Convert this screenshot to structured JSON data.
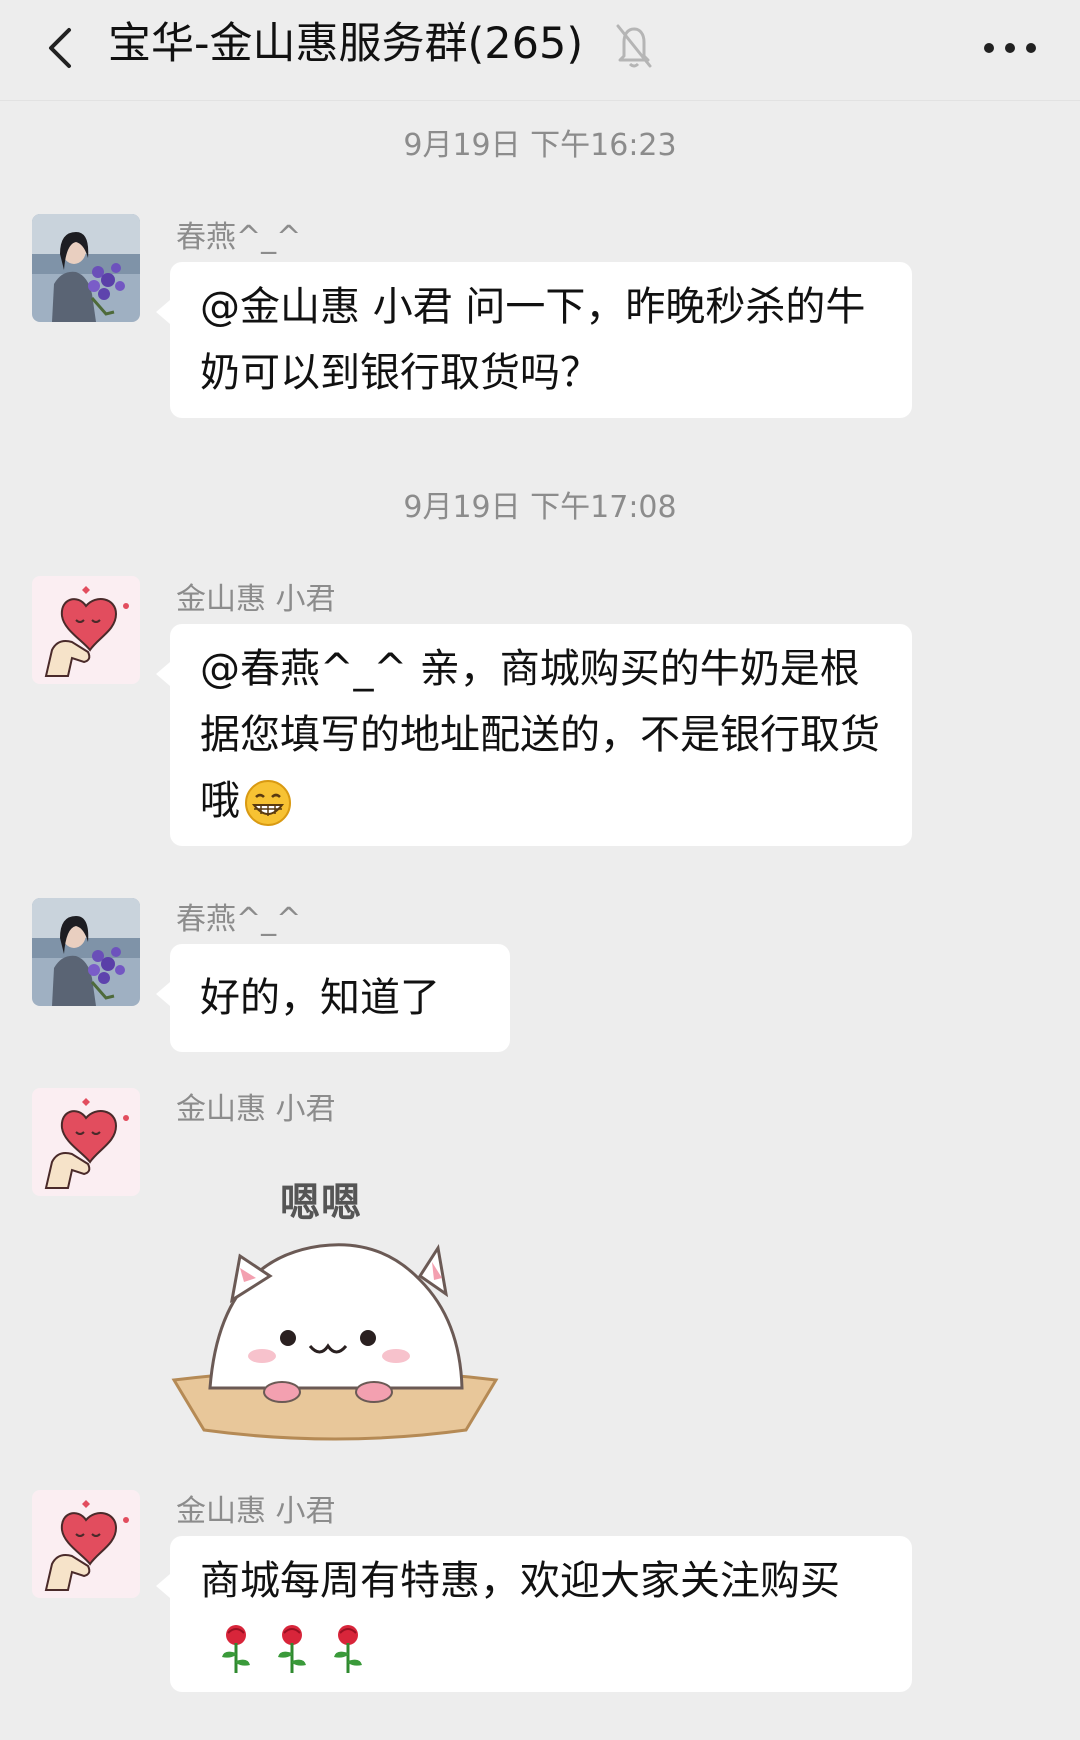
{
  "header": {
    "title": "宝华-金山惠服务群(265)",
    "back_icon": "chevron-left-icon",
    "mute_icon": "bell-off-icon",
    "more_icon": "more-dots-icon"
  },
  "timestamps": [
    "9月19日 下午16:23",
    "9月19日 下午17:08"
  ],
  "messages": [
    {
      "sender": "春燕^_^",
      "avatar": "woman-lavender-photo",
      "text": "@金山惠 小君  问一下，昨晚秒杀的牛奶可以到银行取货吗？"
    },
    {
      "sender": "金山惠 小君",
      "avatar": "heart-hand-avatar",
      "text": "@春燕^_^ 亲，商城购买的牛奶是根据您填写的地址配送的，不是银行取货哦",
      "emoji": "grinning-face-emoji"
    },
    {
      "sender": "春燕^_^",
      "avatar": "woman-lavender-photo",
      "text": "好的，知道了"
    },
    {
      "sender": "金山惠 小君",
      "avatar": "heart-hand-avatar",
      "sticker_text": "嗯嗯",
      "sticker": "cute-cat-sticker"
    },
    {
      "sender": "金山惠 小君",
      "avatar": "heart-hand-avatar",
      "text": "商城每周有特惠，欢迎大家关注购买",
      "emoji": "rose-emoji"
    }
  ]
}
